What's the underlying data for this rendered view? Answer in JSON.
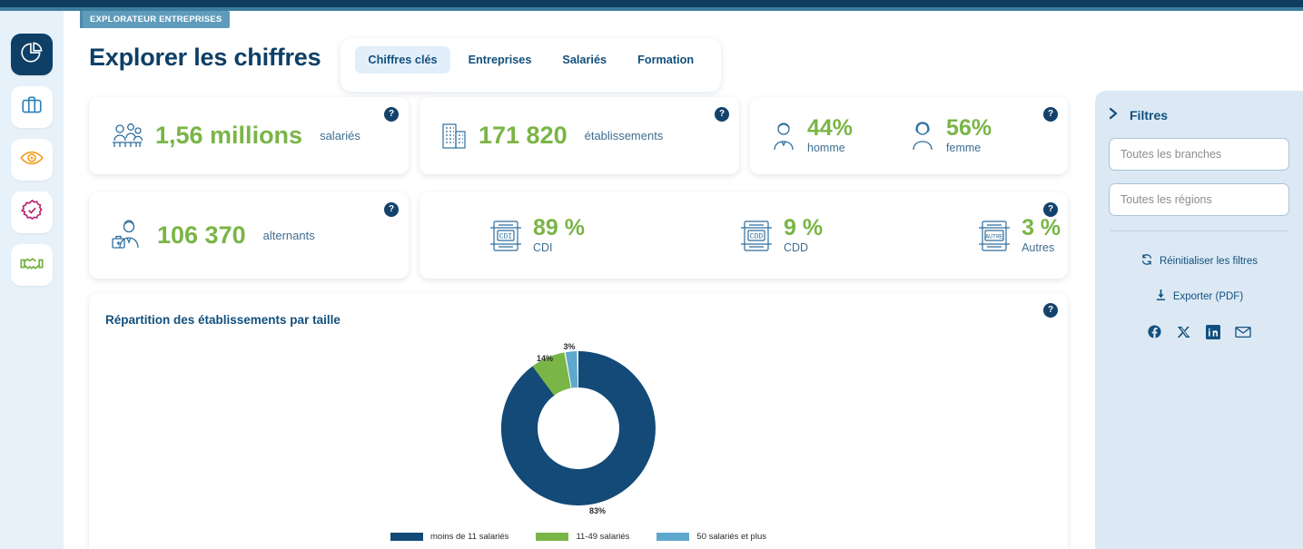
{
  "brand": {
    "badge": "EXPLORATEUR ENTREPRISES",
    "navy": "#0e3f66",
    "green": "#7ab547",
    "teal": "#5f9cbb",
    "panel_blue": "#dce9f5"
  },
  "header": {
    "title": "Explorer les chiffres",
    "tabs": [
      {
        "label": "Chiffres clés",
        "active": true
      },
      {
        "label": "Entreprises",
        "active": false
      },
      {
        "label": "Salariés",
        "active": false
      },
      {
        "label": "Formation",
        "active": false
      }
    ]
  },
  "rail": {
    "items": [
      {
        "name": "pie-chart-icon",
        "active": true
      },
      {
        "name": "briefcase-icon",
        "active": false
      },
      {
        "name": "eye-icon",
        "active": false
      },
      {
        "name": "badge-check-icon",
        "active": false
      },
      {
        "name": "handshake-icon",
        "active": false
      }
    ]
  },
  "cards": {
    "salaries": {
      "value": "1,56 millions",
      "unit": "salariés",
      "help": "?"
    },
    "etablissements": {
      "value": "171 820",
      "unit": "établissements",
      "help": "?"
    },
    "genre": {
      "help": "?",
      "homme": {
        "value": "44%",
        "label": "homme"
      },
      "femme": {
        "value": "56%",
        "label": "femme"
      }
    },
    "alternants": {
      "value": "106 370",
      "unit": "alternants",
      "help": "?"
    },
    "contrats": {
      "help": "?",
      "items": [
        {
          "icon_text": "CDI",
          "value": "89 %",
          "label": "CDI"
        },
        {
          "icon_text": "CDD",
          "value": "9 %",
          "label": "CDD"
        },
        {
          "icon_text": "AUTRE",
          "value": "3 %",
          "label": "Autres"
        }
      ]
    }
  },
  "chart_card": {
    "title": "Répartition des établissements par taille",
    "help": "?"
  },
  "chart_data": {
    "type": "pie",
    "title": "Répartition des établissements par taille",
    "labels": [
      "moins de 11 salariés",
      "11-49 salariés",
      "50 salariés et plus"
    ],
    "values": [
      83,
      14,
      3
    ],
    "value_labels": [
      "83%",
      "14%",
      "3%"
    ],
    "colors": [
      "#134a77",
      "#7ab547",
      "#5fa8cd"
    ],
    "donut": true,
    "inner_radius_ratio": 0.53,
    "legend_position": "bottom",
    "grid": false
  },
  "filters": {
    "title": "Filtres",
    "branch_select": {
      "value": "Toutes les branches"
    },
    "region_select": {
      "value": "Toutes les régions"
    },
    "reset_label": "Réinitialiser les filtres",
    "export_label": "Exporter (PDF)",
    "socials": [
      "facebook-icon",
      "x-icon",
      "linkedin-icon",
      "email-icon"
    ]
  }
}
